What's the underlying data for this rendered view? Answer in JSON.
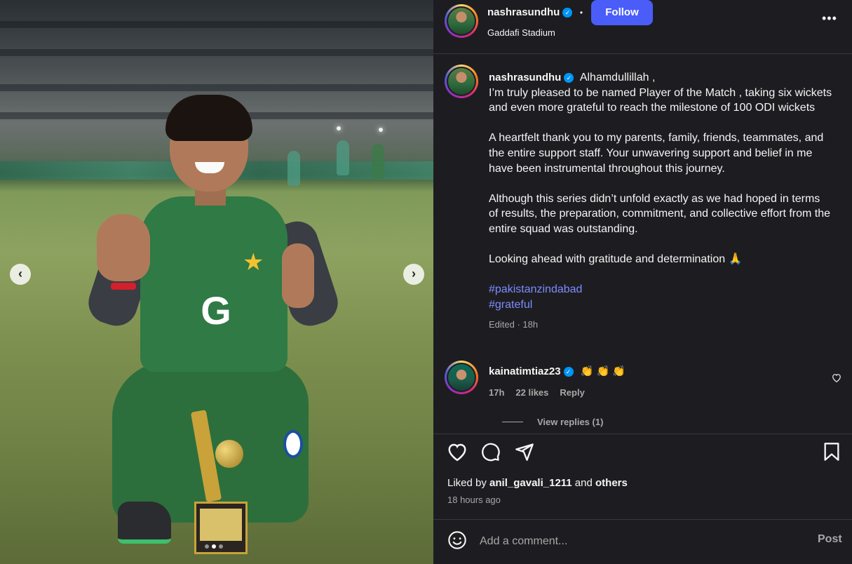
{
  "post": {
    "username": "nashrasundhu",
    "location": "Gaddafi Stadium",
    "follow_label": "Follow",
    "separator": "•",
    "more_label": "•••"
  },
  "carousel": {
    "prev_label": "‹",
    "next_label": "›",
    "slide_count": 3,
    "active_slide": 2
  },
  "caption": {
    "username": "nashrasundhu",
    "first_line": "Alhamdullillah ,",
    "paragraph1": "I’m truly pleased to be named Player of the Match , taking six wickets and even more grateful to reach the milestone of 100 ODI wickets",
    "paragraph2": "A heartfelt thank you to my parents, family, friends, teammates, and the entire support staff. Your unwavering support and belief in me have been instrumental throughout this journey.",
    "paragraph3": "Although this series didn’t unfold exactly as we had hoped in terms of results, the preparation, commitment, and collective effort from the entire squad was outstanding.",
    "paragraph4": "Looking ahead with gratitude and determination 🙏",
    "hashtag1": "#pakistanzindabad",
    "hashtag2": "#grateful",
    "meta": "Edited · 18h"
  },
  "comment": {
    "username": "kainatimtiaz23",
    "text": "👏 👏 👏",
    "time": "17h",
    "likes": "22 likes",
    "reply_label": "Reply",
    "view_replies": "View replies (1)"
  },
  "engagement": {
    "liked_by_prefix": "Liked by ",
    "liked_by_user": "anil_gavali_1211",
    "liked_by_and": " and ",
    "liked_by_others": "others",
    "time_ago": "18 hours ago"
  },
  "comment_bar": {
    "placeholder": "Add a comment...",
    "post_label": "Post"
  },
  "colors": {
    "background": "#1d1d21",
    "follow_button": "#4a5df9",
    "hashtag": "#7d8bff",
    "verified": "#0095f6"
  }
}
